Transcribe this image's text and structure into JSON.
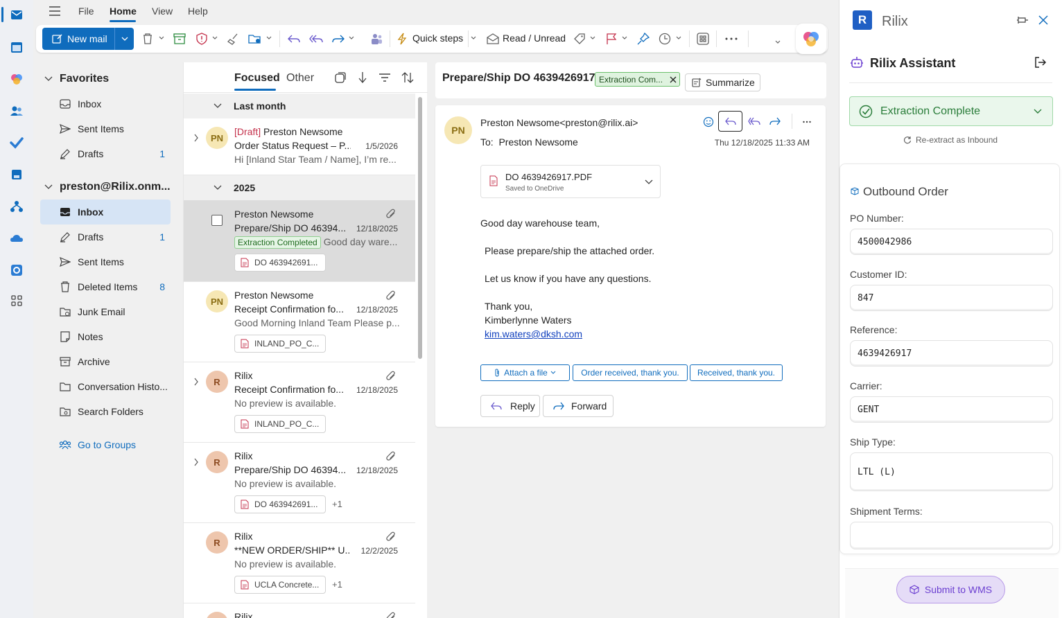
{
  "menubar": {
    "items": [
      "File",
      "Home",
      "View",
      "Help"
    ],
    "active": "Home"
  },
  "ribbon": {
    "new_mail": "New mail",
    "quick_steps": "Quick steps",
    "read_unread": "Read / Unread"
  },
  "folders": {
    "favorites_label": "Favorites",
    "favorites": [
      {
        "label": "Inbox",
        "count": ""
      },
      {
        "label": "Sent Items",
        "count": ""
      },
      {
        "label": "Drafts",
        "count": "1"
      }
    ],
    "account_label": "preston@Rilix.onm...",
    "account": [
      {
        "label": "Inbox",
        "count": ""
      },
      {
        "label": "Drafts",
        "count": "1"
      },
      {
        "label": "Sent Items",
        "count": ""
      },
      {
        "label": "Deleted Items",
        "count": "8"
      },
      {
        "label": "Junk Email",
        "count": ""
      },
      {
        "label": "Notes",
        "count": ""
      },
      {
        "label": "Archive",
        "count": ""
      },
      {
        "label": "Conversation Histo...",
        "count": ""
      },
      {
        "label": "Search Folders",
        "count": ""
      }
    ],
    "go_to_groups": "Go to Groups"
  },
  "list": {
    "tabs": [
      "Focused",
      "Other"
    ],
    "groups": [
      "Last month",
      "2025"
    ],
    "messages": [
      {
        "avatar": "PN",
        "draft_tag": "[Draft]",
        "sender": "Preston Newsome",
        "subject": "Order Status Request – P...",
        "date": "1/5/2026",
        "preview": "Hi [Inland Star Team / Name], I’m re...",
        "attachment": "",
        "extra": ""
      },
      {
        "avatar": "",
        "draft_tag": "",
        "sender": "Preston Newsome",
        "subject": "Prepare/Ship DO 46394...",
        "date": "12/18/2025",
        "badge": "Extraction Completed",
        "preview": "Good day ware...",
        "attachment": "DO 463942691...",
        "extra": ""
      },
      {
        "avatar": "PN",
        "draft_tag": "",
        "sender": "Preston Newsome",
        "subject": "Receipt Confirmation fo...",
        "date": "12/18/2025",
        "preview": "Good Morning Inland Team Please p...",
        "attachment": "INLAND_PO_C...",
        "extra": ""
      },
      {
        "avatar": "R",
        "draft_tag": "",
        "sender": "Rilix",
        "subject": "Receipt Confirmation fo...",
        "date": "12/18/2025",
        "preview": "No preview is available.",
        "attachment": "INLAND_PO_C...",
        "extra": ""
      },
      {
        "avatar": "R",
        "draft_tag": "",
        "sender": "Rilix",
        "subject": "Prepare/Ship DO 46394...",
        "date": "12/18/2025",
        "preview": "No preview is available.",
        "attachment": "DO 463942691...",
        "extra": "+1"
      },
      {
        "avatar": "R",
        "draft_tag": "",
        "sender": "Rilix",
        "subject": "**NEW ORDER/SHIP** U...",
        "date": "12/2/2025",
        "preview": "No preview is available.",
        "attachment": "UCLA Concrete...",
        "extra": "+1"
      },
      {
        "avatar": "R",
        "draft_tag": "",
        "sender": "Rilix",
        "subject": "",
        "date": "",
        "preview": "",
        "attachment": "",
        "extra": ""
      }
    ]
  },
  "reading": {
    "subject": "Prepare/Ship DO 4639426917",
    "category_tag": "Extraction Com...",
    "summarize": "Summarize",
    "avatar": "PN",
    "from": "Preston Newsome<preston@rilix.ai>",
    "to_label": "To:",
    "to": "Preston Newsome",
    "datetime": "Thu 12/18/2025 11:33 AM",
    "attachment_name": "DO 4639426917.PDF",
    "attachment_sub": "Saved to OneDrive",
    "body": [
      "Good day warehouse team,",
      "Please prepare/ship the attached order.",
      "Let us know if you have any questions.",
      "Thank you,",
      "Kimberlynne Waters"
    ],
    "email_link": "kim.waters@dksh.com",
    "suggestions": [
      "Attach a file",
      "Order received, thank you.",
      "Received, thank you."
    ],
    "reply": "Reply",
    "forward": "Forward"
  },
  "addin": {
    "brand_letter": "R",
    "brand": "Rilix",
    "title": "Rilix Assistant",
    "status": "Extraction Complete",
    "reextract": "Re-extract as Inbound",
    "section": "Outbound Order",
    "fields": [
      {
        "label": "PO Number:",
        "value": "4500042986"
      },
      {
        "label": "Customer ID:",
        "value": "847"
      },
      {
        "label": "Reference:",
        "value": "4639426917"
      },
      {
        "label": "Carrier:",
        "value": "GENT"
      },
      {
        "label": "Ship Type:",
        "value": "LTL (L)"
      },
      {
        "label": "Shipment Terms:",
        "value": ""
      }
    ],
    "submit": "Submit to WMS"
  },
  "colors": {
    "accent": "#0f6cbd",
    "success": "#1e6a1e",
    "submit_purple": "#6b3fd1"
  }
}
